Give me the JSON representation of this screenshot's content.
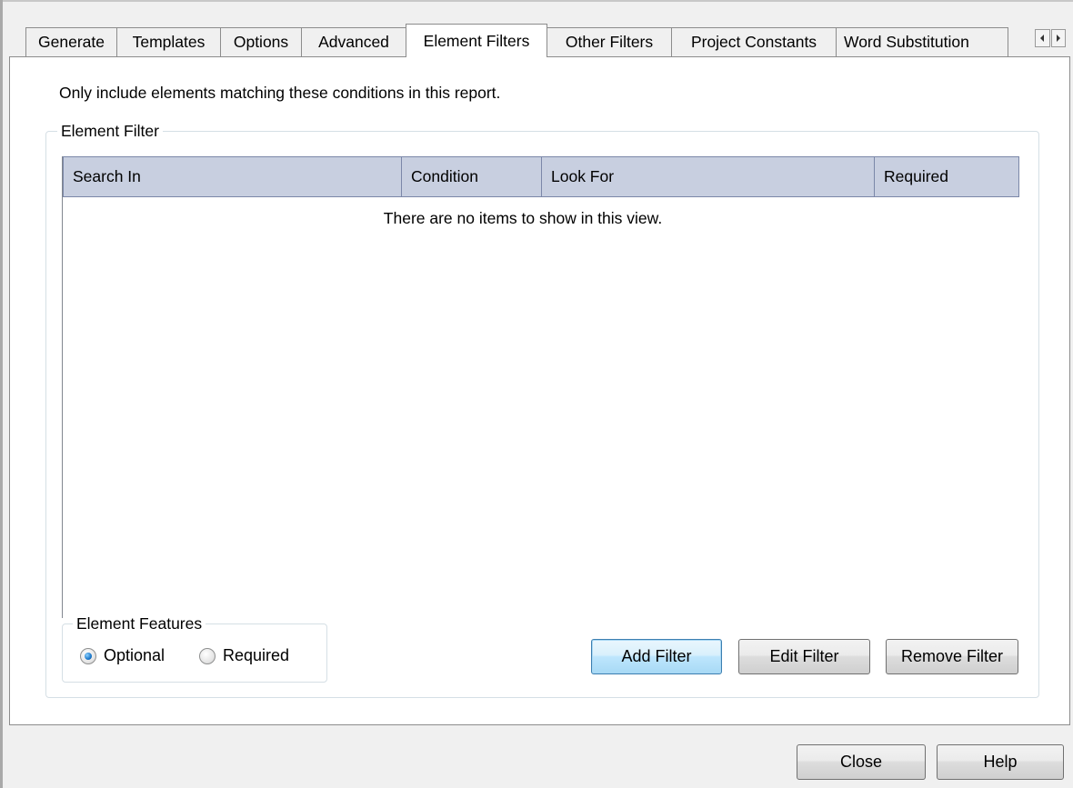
{
  "tabs": [
    {
      "label": "Generate"
    },
    {
      "label": "Templates"
    },
    {
      "label": "Options"
    },
    {
      "label": "Advanced"
    },
    {
      "label": "Element Filters",
      "active": true
    },
    {
      "label": "Other Filters"
    },
    {
      "label": "Project Constants"
    },
    {
      "label": "Word Substitution"
    }
  ],
  "tab_scroll": {
    "left_icon": "scroll-left-icon",
    "right_icon": "scroll-right-icon"
  },
  "intro_text": "Only include elements matching these conditions in this report.",
  "element_filter": {
    "legend": "Element Filter",
    "columns": [
      "Search In",
      "Condition",
      "Look For",
      "Required"
    ],
    "empty_message": "There are no items to show in this view."
  },
  "element_features": {
    "legend": "Element Features",
    "options": [
      {
        "label": "Optional",
        "checked": true
      },
      {
        "label": "Required",
        "checked": false
      }
    ]
  },
  "buttons": {
    "add_filter": "Add Filter",
    "edit_filter": "Edit Filter",
    "remove_filter": "Remove Filter",
    "close": "Close",
    "help": "Help"
  },
  "colors": {
    "header_bg": "#c8cfe0",
    "default_button_border": "#3c7fb1",
    "window_bg": "#f0f0f0"
  }
}
